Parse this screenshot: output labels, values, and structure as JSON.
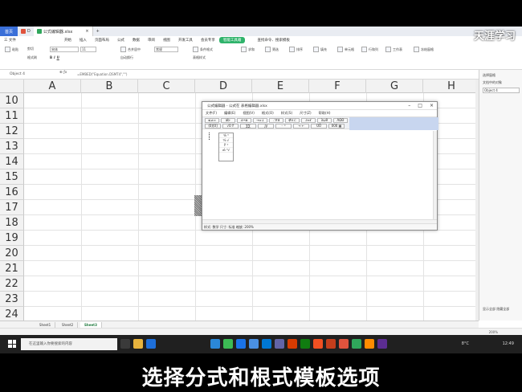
{
  "watermark": "天涯学习",
  "titlebar": {
    "home_tab": "首页",
    "tab2": "D",
    "doc_tab": "公式编辑器.xlsx",
    "add_tab": "+"
  },
  "menu": {
    "items": [
      "三 文件",
      "开始",
      "插入",
      "页面布局",
      "公式",
      "数据",
      "审阅",
      "视图",
      "开发工具",
      "会员专享"
    ],
    "green_button": "智能工具箱",
    "search": "查找命令、搜索模板"
  },
  "ribbon": {
    "font_name": "宋体",
    "font_size": "11",
    "number_format": "常规",
    "labels": [
      "粘贴",
      "剪切",
      "格式刷",
      "合并居中",
      "自动换行",
      "条件格式",
      "表格样式",
      "求和",
      "筛选",
      "排序",
      "填充",
      "单元格",
      "行和列",
      "工作表",
      "冻结窗格"
    ]
  },
  "formula_bar": {
    "name_box": "Object 4",
    "formula": "=EMBED(\"Equation.DSMT4\",\"\")"
  },
  "sheet": {
    "columns": [
      "A",
      "B",
      "C",
      "D",
      "E",
      "F",
      "G",
      "H"
    ],
    "rows": [
      "10",
      "11",
      "12",
      "13",
      "14",
      "15",
      "16",
      "17",
      "18",
      "19",
      "20",
      "21",
      "22",
      "23",
      "24"
    ]
  },
  "dialog": {
    "title": "公式编辑器 - 公式在 表格编辑器.xlsx",
    "menu": [
      "文件(F)",
      "编辑(E)",
      "视图(V)",
      "格式(O)",
      "样式(S)",
      "尺寸(Z)",
      "帮助(H)"
    ],
    "toolbar_row1": [
      "≤≠≈",
      "ab·",
      "±•⊗",
      "→⇔↓",
      "∴∀∃",
      "∉∩⊂",
      "∂∞ℓ",
      "λωθ",
      "ΛΩΘ"
    ],
    "toolbar_row2": [
      "(0)[0]",
      "√0 ∛",
      "∑∑",
      "∫∮",
      "⁻ ⁼",
      "→ ←",
      "ŪŮ",
      "000 ▦"
    ],
    "palette": [
      "⁰⁄₀ ⁰",
      "⁰⁄₀ √",
      "∜ ⁰",
      "₀⁄₀ ⁰√"
    ],
    "status": "样式: 数学  尺寸: 标准  缩放: 200%"
  },
  "right_pane": {
    "title": "选择窗格",
    "subtitle": "文档中的对象",
    "item": "Object 4",
    "footer": "显示全部  隐藏全部"
  },
  "sheet_tabs": [
    "Sheet1",
    "Sheet2",
    "Sheet3"
  ],
  "status": {
    "zoom": "200%"
  },
  "taskbar": {
    "search_placeholder": "在这里输入你要搜索的内容",
    "weather": "8°C",
    "time": "12:49"
  },
  "subtitle": "选择分式和根式模板选项"
}
